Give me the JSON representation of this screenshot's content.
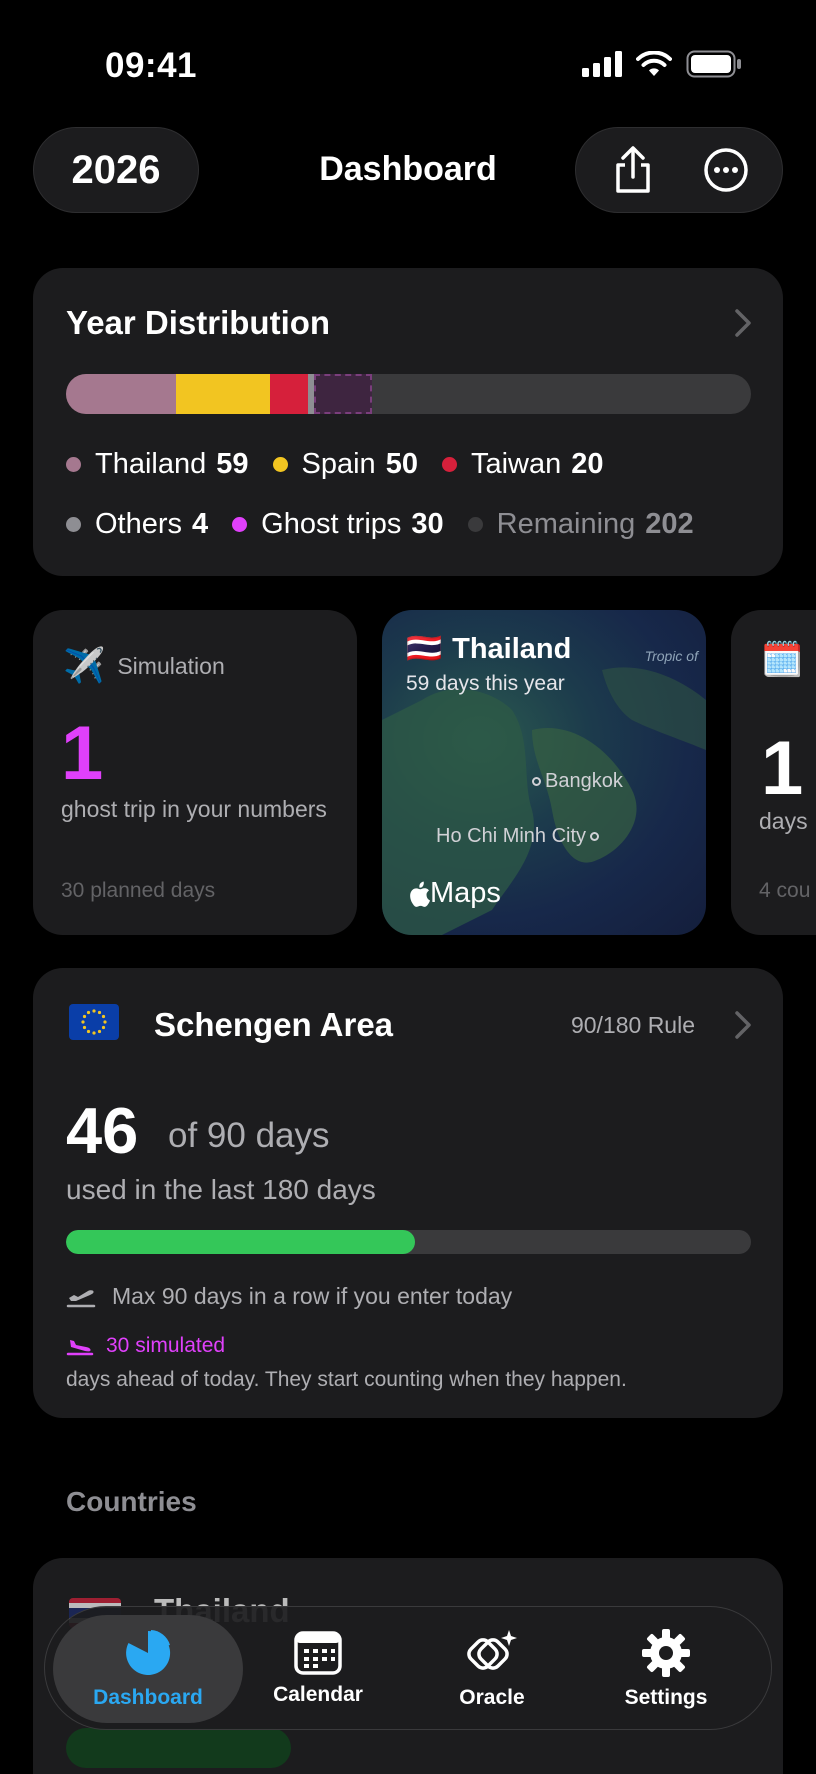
{
  "status": {
    "time": "09:41"
  },
  "header": {
    "year": "2026",
    "title": "Dashboard"
  },
  "distribution": {
    "title": "Year Distribution",
    "legend": [
      {
        "name": "Thailand",
        "value": "59",
        "color": "#a5788f"
      },
      {
        "name": "Spain",
        "value": "50",
        "color": "#f2c521"
      },
      {
        "name": "Taiwan",
        "value": "20",
        "color": "#d6203b"
      },
      {
        "name": "Others",
        "value": "4",
        "color": "#8e8e93"
      },
      {
        "name": "Ghost trips",
        "value": "30",
        "color": "#e040fb"
      },
      {
        "name": "Remaining",
        "value": "202",
        "color": "#3a3a3c"
      }
    ]
  },
  "simulation": {
    "label": "Simulation",
    "count": "1",
    "description": "ghost trip in your numbers",
    "footer": "30 planned days"
  },
  "map_card": {
    "flag": "🇹🇭",
    "country": "Thailand",
    "subtitle": "59 days this year",
    "city1": "Bangkok",
    "city2": "Ho Chi Minh City",
    "tropic": "Tropic of",
    "brand": "Maps",
    "edge_label": "of"
  },
  "peek_card": {
    "number": "1",
    "description": "days",
    "footer": "4 cou"
  },
  "schengen": {
    "title": "Schengen Area",
    "rule": "90/180 Rule",
    "used": "46",
    "of_total": "of 90 days",
    "period": "used in the last 180 days",
    "progress_fraction": 0.51,
    "max_note": "Max 90 days in a row if you enter today",
    "simulated": "30 simulated",
    "ahead_note": "days ahead of today. They start counting when they happen."
  },
  "countries": {
    "title": "Countries",
    "first": "Thailand"
  },
  "tabs": [
    {
      "label": "Dashboard",
      "active": true
    },
    {
      "label": "Calendar",
      "active": false
    },
    {
      "label": "Oracle",
      "active": false
    },
    {
      "label": "Settings",
      "active": false
    }
  ],
  "colors": {
    "accent": "#2aa8f2",
    "ghost": "#e040fb",
    "schengen_fill": "#34c759"
  }
}
